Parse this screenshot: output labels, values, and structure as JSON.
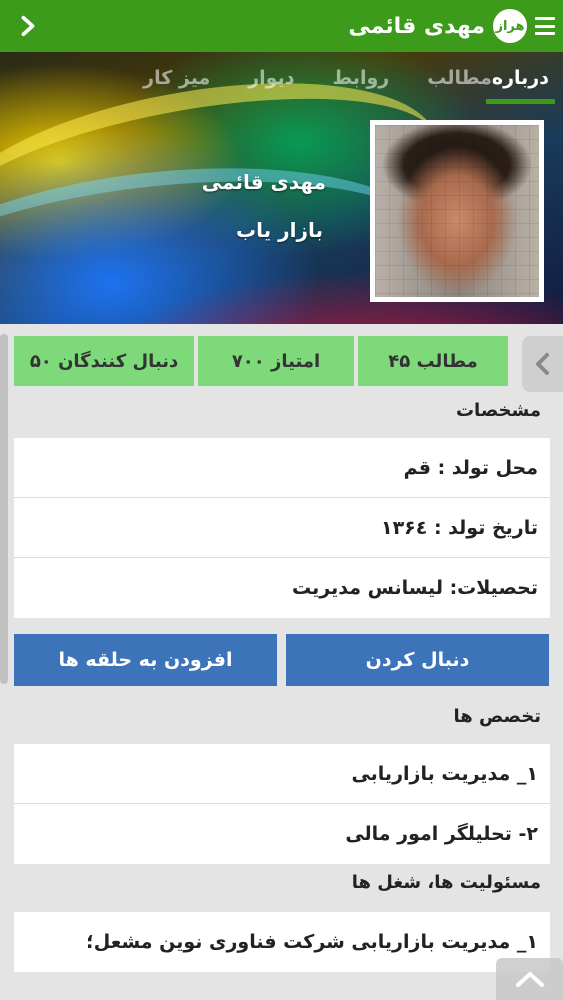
{
  "header": {
    "title": "مهدی قائمی",
    "logo_text": "هراز",
    "back_icon": "chevron-right-icon",
    "menu_icon": "hamburger-menu-icon",
    "bar_color": "#3d9b1c"
  },
  "tabs": [
    {
      "label": "درباره",
      "active": true
    },
    {
      "label": "مطالب",
      "active": false
    },
    {
      "label": "روابط",
      "active": false
    },
    {
      "label": "دیوار",
      "active": false
    },
    {
      "label": "میز کار",
      "active": false
    }
  ],
  "profile": {
    "name": "مهدی قائمی",
    "role": "بازار یاب"
  },
  "stats": {
    "posts": "مطالب ۴۵",
    "points": "امتیاز ۷۰۰",
    "followers": "دنبال کنندگان ۵۰",
    "color": "#7dd97a"
  },
  "details": {
    "title": "مشخصات",
    "rows": [
      "محل تولد : قم",
      "تاریخ تولد : ۱۳۶٤",
      "تحصیلات: لیسانس مدیریت"
    ]
  },
  "actions": {
    "follow": "دنبال کردن",
    "add_to_circles": "افزودن به حلقه ها",
    "color": "#3d73b9"
  },
  "specialties": {
    "title": "تخصص ها",
    "rows": [
      "۱_ مدیریت بازاریابی",
      "۲- تحلیلگر امور مالی"
    ]
  },
  "responsibilities": {
    "title": "مسئولیت ها، شغل ها",
    "rows": [
      "۱_ مدیریت بازاریابی شرکت فناوری نوین مشعل؛"
    ]
  }
}
